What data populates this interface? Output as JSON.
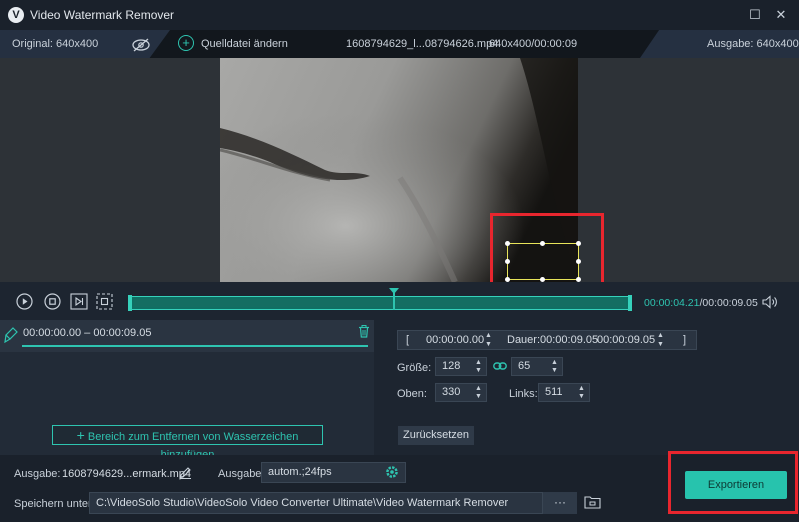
{
  "window": {
    "title": "Video Watermark Remover",
    "logo_glyph": "V",
    "maximize_glyph": "☐",
    "close_glyph": "✕"
  },
  "info_bar": {
    "original": "Original: 640x400",
    "change_source": "Quelldatei ändern",
    "file_name": "1608794629_l...08794626.mp4",
    "file_meta": "640x400/00:00:09",
    "output": "Ausgabe: 640x400"
  },
  "timeline": {
    "current_time": "00:00:04.21",
    "total_time": "/00:00:09.05",
    "playhead_fraction": 0.527
  },
  "segment": {
    "range": "00:00:00.00 – 00:00:09.05"
  },
  "region": {
    "open_bracket": "[",
    "close_bracket": "]",
    "start": "00:00:00.00",
    "duration_label": "Dauer:00:00:09.05",
    "end": "00:00:09.05",
    "size_label": "Größe:",
    "width": "128",
    "height": "65",
    "top_label": "Oben:",
    "top": "330",
    "left_label": "Links:",
    "left": "511",
    "reset_label": "Zurücksetzen"
  },
  "add_area": {
    "label": "Bereich zum Entfernen von Wasserzeichen hinzufügen"
  },
  "footer": {
    "output_label": "Ausgabe:",
    "output_file": "1608794629...ermark.mp4",
    "format_label": "Ausgabe:",
    "format_value": "autom.;24fps",
    "save_label": "Speichern unter:",
    "save_path": "C:\\VideoSolo Studio\\VideoSolo Video Converter Ultimate\\Video Watermark Remover",
    "more_glyph": "···",
    "export_label": "Exportieren"
  },
  "colors": {
    "accent": "#2ec4b0",
    "highlight_red": "#e8262e",
    "selection_yellow": "#e8e45a"
  },
  "icons": [
    "logo-icon",
    "maximize-icon",
    "close-icon",
    "eye-off-icon",
    "add-circle-icon",
    "play-icon",
    "stop-icon",
    "step-forward-icon",
    "clip-icon",
    "volume-icon",
    "brush-icon",
    "trash-icon",
    "spin-up-icon",
    "spin-down-icon",
    "link-icon",
    "plus-icon",
    "pencil-icon",
    "gear-icon",
    "folder-icon"
  ]
}
